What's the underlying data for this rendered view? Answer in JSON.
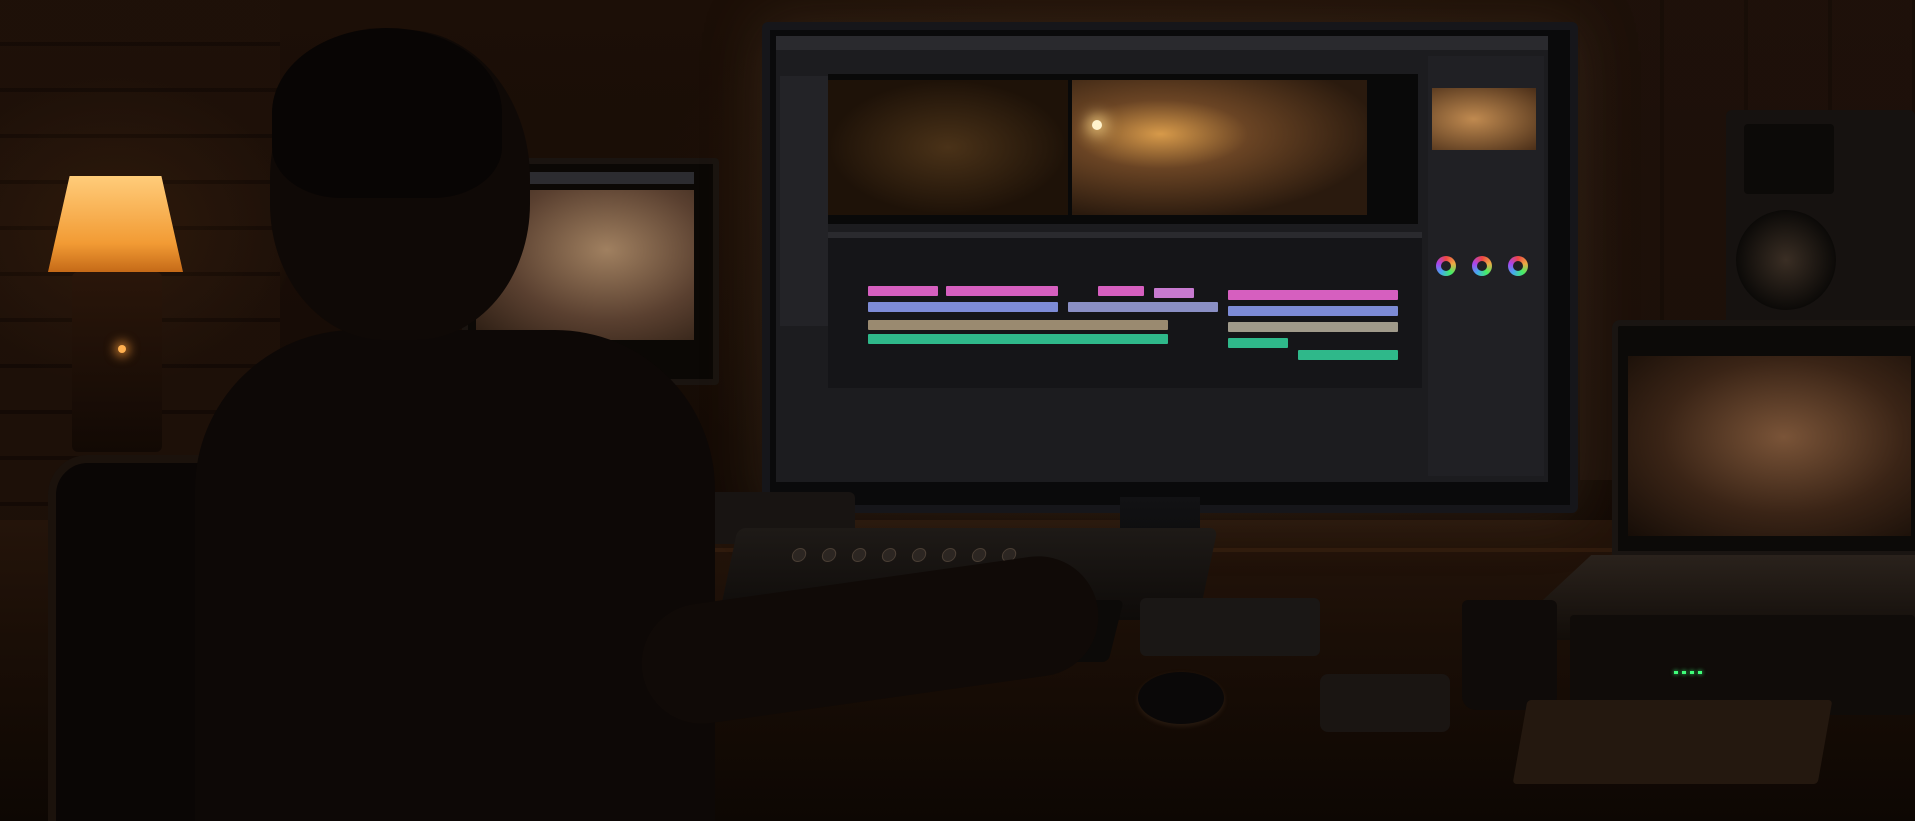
{
  "scene": {
    "description_free": true
  },
  "colors": {
    "lamp_glow": "#f29b34",
    "clip_pink": "#d65fbf",
    "clip_green": "#2fb88a",
    "clip_blue": "#7d8bd6",
    "led_green": "#3fff7a"
  },
  "icons": [
    "color-wheel-icon",
    "speaker-icon",
    "lamp-icon"
  ]
}
